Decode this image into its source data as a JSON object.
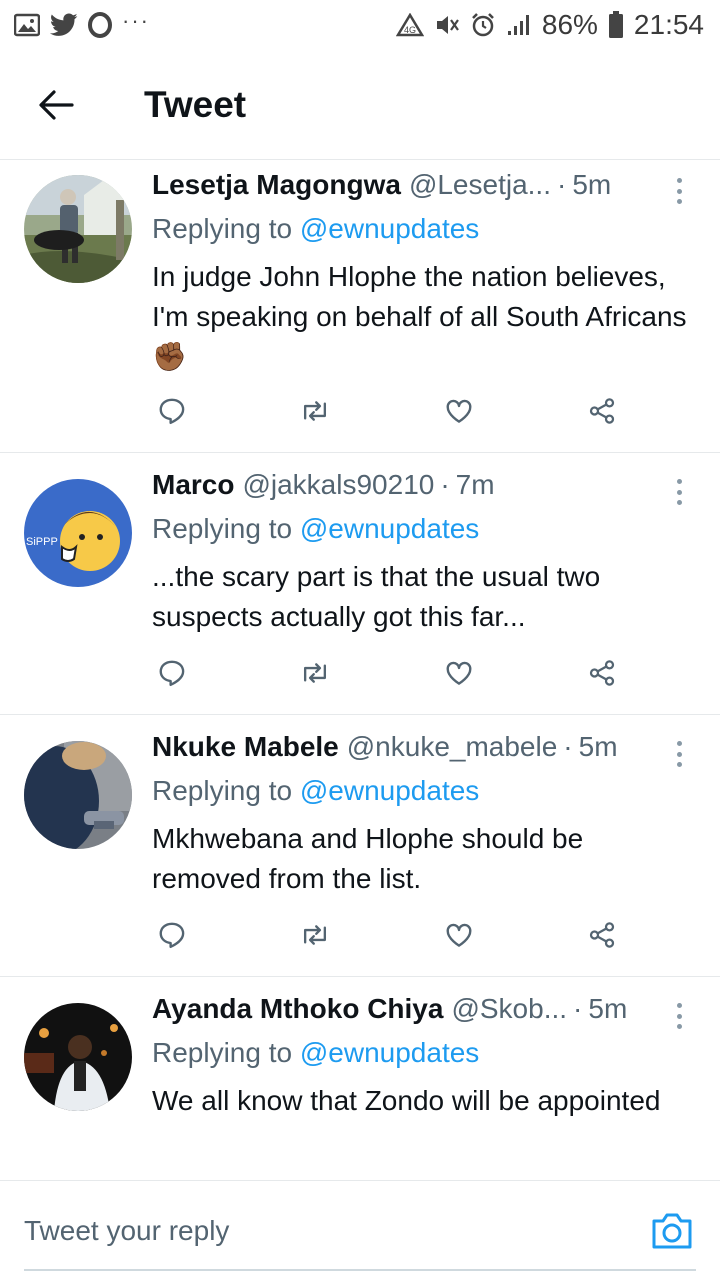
{
  "status_bar": {
    "battery_percent": "86%",
    "time": "21:54",
    "dots": "···"
  },
  "header": {
    "title": "Tweet"
  },
  "tweets": [
    {
      "name": "Lesetja Magongwa",
      "handle": "@Lesetja...",
      "time": "5m",
      "replying_prefix": "Replying to",
      "replying_to": "@ewnupdates",
      "text": "In judge John Hlophe the nation believes, I'm speaking on behalf of all South Africans✊🏾"
    },
    {
      "name": "Marco",
      "handle": "@jakkals90210",
      "time": "7m",
      "replying_prefix": "Replying to",
      "replying_to": "@ewnupdates",
      "text": "...the scary part is that the usual two suspects actually got this far...",
      "avatar_text": "SiPPP"
    },
    {
      "name": "Nkuke Mabele",
      "handle": "@nkuke_mabele",
      "time": "5m",
      "replying_prefix": "Replying to",
      "replying_to": "@ewnupdates",
      "text": "Mkhwebana and Hlophe should be removed from the list."
    },
    {
      "name": "Ayanda Mthoko Chiya",
      "handle": "@Skob...",
      "time": "5m",
      "replying_prefix": "Replying to",
      "replying_to": "@ewnupdates",
      "text": "We all know that Zondo will be appointed"
    }
  ],
  "reply": {
    "placeholder": "Tweet your reply"
  },
  "colors": {
    "accent": "#1d9bf0",
    "muted": "#536471"
  }
}
